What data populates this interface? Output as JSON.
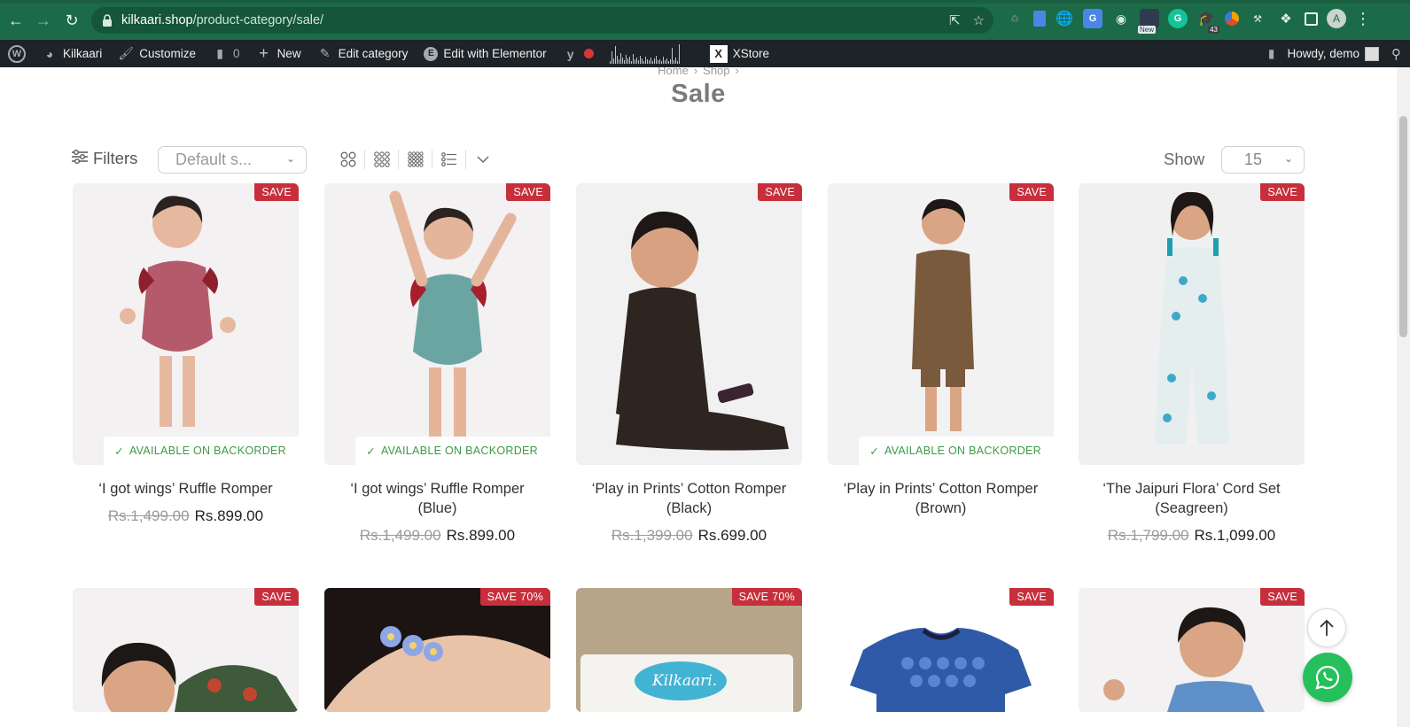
{
  "browser": {
    "url_host": "kilkaari.shop",
    "url_path": "/product-category/sale/",
    "extension_badges": {
      "new": "New",
      "count": "43"
    },
    "profile_initial": "A"
  },
  "admin_bar": {
    "site_name": "Kilkaari",
    "customize": "Customize",
    "comments_count": "0",
    "new": "New",
    "edit_category": "Edit category",
    "edit_elementor": "Edit with Elementor",
    "xstore": "XStore",
    "howdy": "Howdy, demo"
  },
  "page": {
    "breadcrumb": [
      "Home",
      "Shop"
    ],
    "title": "Sale"
  },
  "toolbar": {
    "filters_label": "Filters",
    "sort_value": "Default s...",
    "show_label": "Show",
    "show_value": "15"
  },
  "products": [
    {
      "badge": "SAVE",
      "availability": "AVAILABLE ON BACKORDER",
      "name_line1": "‘I got wings’ Ruffle Romper",
      "name_line2": "",
      "old_price": "Rs.1,499.00",
      "new_price": "Rs.899.00",
      "color": "#b55a6b"
    },
    {
      "badge": "SAVE",
      "availability": "AVAILABLE ON BACKORDER",
      "name_line1": "‘I got wings’ Ruffle Romper",
      "name_line2": "(Blue)",
      "old_price": "Rs.1,499.00",
      "new_price": "Rs.899.00",
      "color": "#6aa5a2"
    },
    {
      "badge": "SAVE",
      "availability": "",
      "name_line1": "‘Play in Prints’ Cotton Romper",
      "name_line2": "(Black)",
      "old_price": "Rs.1,399.00",
      "new_price": "Rs.699.00",
      "color": "#2e2521"
    },
    {
      "badge": "SAVE",
      "availability": "AVAILABLE ON BACKORDER",
      "name_line1": "‘Play in Prints’ Cotton Romper",
      "name_line2": "(Brown)",
      "old_price": "",
      "new_price": "",
      "color": "#7a5a3c"
    },
    {
      "badge": "SAVE",
      "availability": "",
      "name_line1": "‘The Jaipuri Flora’ Cord Set",
      "name_line2": "(Seagreen)",
      "old_price": "Rs.1,799.00",
      "new_price": "Rs.1,099.00",
      "color": "#e4eeee"
    }
  ],
  "products_row2": [
    {
      "badge": "SAVE"
    },
    {
      "badge": "SAVE 70%"
    },
    {
      "badge": "SAVE 70%",
      "brand_tag": "Kilkaari."
    },
    {
      "badge": "SAVE"
    },
    {
      "badge": "SAVE"
    }
  ],
  "colors": {
    "accent": "#c62f3b",
    "available": "#3d9a45",
    "chrome": "#1c6b48",
    "admin_bar": "#1d2327",
    "whatsapp": "#25c05c"
  }
}
